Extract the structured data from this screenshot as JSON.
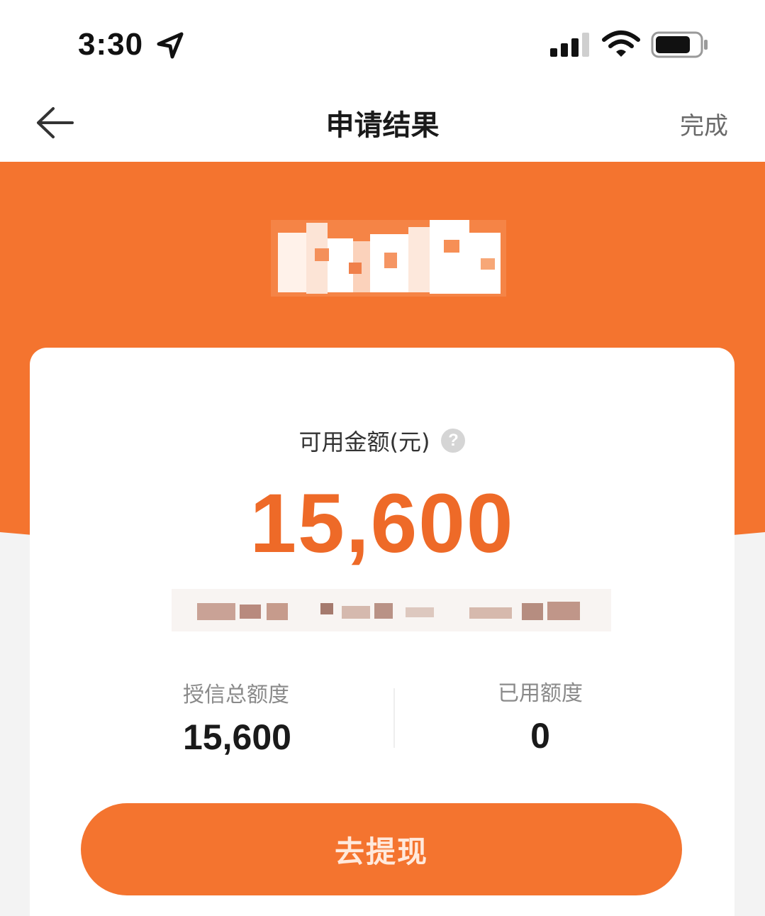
{
  "status_bar": {
    "time": "3:30",
    "icons": [
      "location-arrow-icon",
      "cellular-signal-icon",
      "wifi-icon",
      "battery-icon"
    ]
  },
  "nav": {
    "back_icon": "arrow-left-icon",
    "title": "申请结果",
    "done_label": "完成"
  },
  "card": {
    "available_label": "可用金额(元)",
    "help_glyph": "?",
    "available_amount": "15,600",
    "total_credit_label": "授信总额度",
    "total_credit_value": "15,600",
    "used_credit_label": "已用额度",
    "used_credit_value": "0"
  },
  "actions": {
    "withdraw_label": "去提现"
  },
  "colors": {
    "accent": "#f4742f",
    "amount": "#ee6a28",
    "background": "#f3f3f3",
    "card": "#ffffff"
  }
}
